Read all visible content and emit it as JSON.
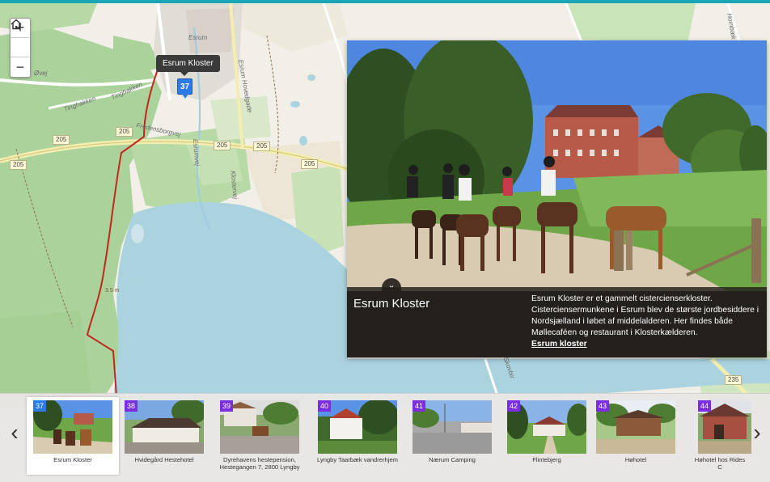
{
  "map": {
    "zoom_in": "+",
    "home": "⌂",
    "zoom_out": "−",
    "tooltip": "Esrum Kloster",
    "marker_number": "37",
    "road_labels": [
      "205",
      "205",
      "205",
      "205",
      "205",
      "205",
      "235"
    ],
    "street_labels": [
      "Esrum",
      "Øvej",
      "Tinghakken",
      "Tinghakken",
      "Fredensborgvej",
      "Esrum Hovedgade",
      "Esrumvej",
      "Klostervej",
      "Skovbo",
      "Hornbæk"
    ],
    "distance_label": "3.5 m"
  },
  "panel": {
    "title": "Esrum Kloster",
    "description": "Esrum Kloster er et gammelt cistercienserkloster. Cisterciensermunkene i Esrum blev de største jordbesiddere i Nordsjælland i løbet af middelalderen. Her findes både Møllecaféen og restaurant i Klosterkælderen.",
    "link": "Esrum kloster",
    "toggle_icon": "⌄"
  },
  "carousel": {
    "prev": "‹",
    "next": "›",
    "items": [
      {
        "number": "37",
        "label": "Esrum Kloster"
      },
      {
        "number": "38",
        "label": "Hvidegård Hestehotel"
      },
      {
        "number": "39",
        "label": "Dyrehavens hestepension, Hestegangen 7, 2800 Lyngby"
      },
      {
        "number": "40",
        "label": "Lyngby Taarbæk vandrerhjem"
      },
      {
        "number": "41",
        "label": "Nærum Camping"
      },
      {
        "number": "42",
        "label": "Flintebjerg"
      },
      {
        "number": "43",
        "label": "Høhotel"
      },
      {
        "number": "44",
        "label": "Høhotel hos Rides C"
      }
    ]
  },
  "colors": {
    "accent": "#1aa6b7",
    "active_badge": "#2c7be5",
    "badge": "#7b2ee0",
    "route": "#c0281f",
    "forest": "#a8d49a",
    "water": "#aad3df"
  }
}
